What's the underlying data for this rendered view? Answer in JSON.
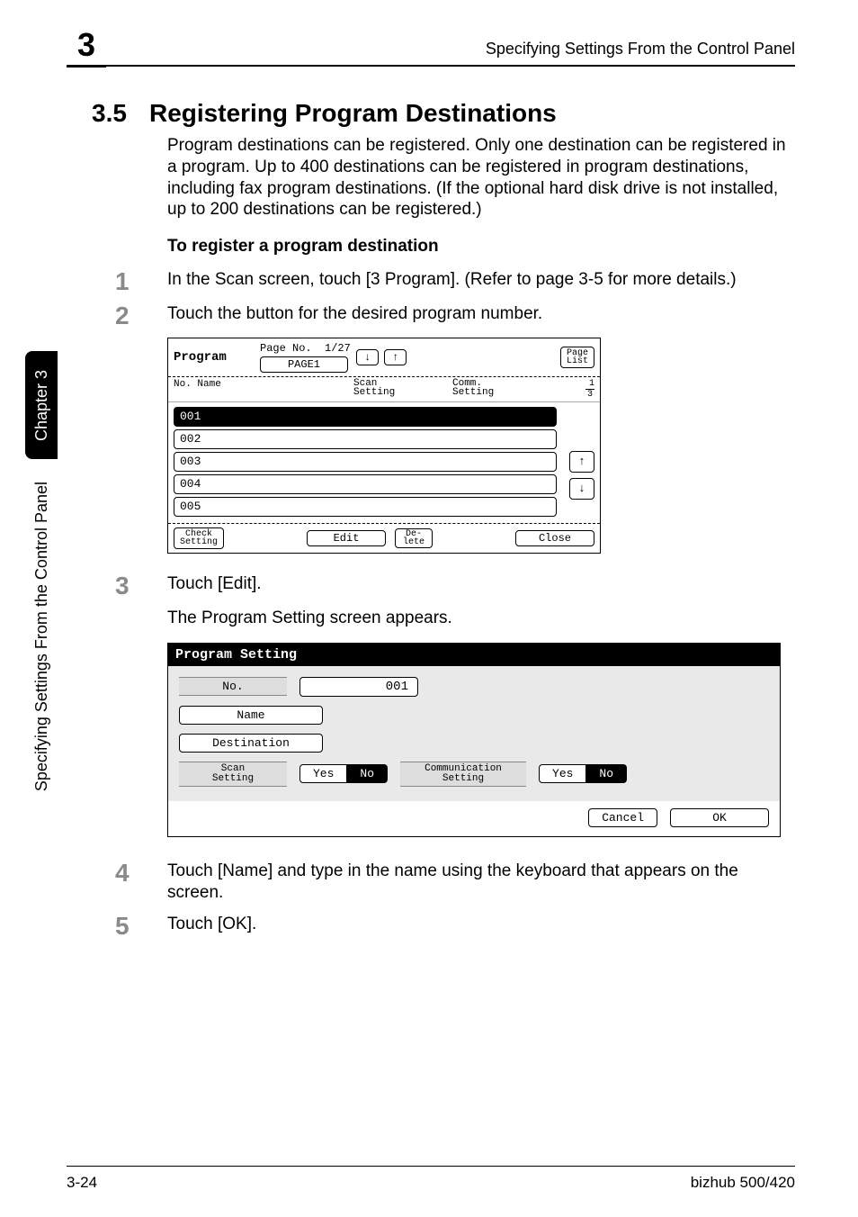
{
  "header": {
    "chapter_number": "3",
    "running_title": "Specifying Settings From the Control Panel"
  },
  "sidetab": {
    "chapter_label": "Chapter 3",
    "side_title": "Specifying Settings From the Control Panel"
  },
  "section": {
    "number": "3.5",
    "title": "Registering Program Destinations",
    "intro": "Program destinations can be registered. Only one destination can be registered in a program. Up to 400 destinations can be registered in program destinations, including fax program destinations. (If the optional hard disk drive is not installed, up to 200 destinations can be registered.)",
    "procedure_title": "To register a program destination"
  },
  "steps": [
    {
      "num": "1",
      "text": "In the Scan screen, touch [3 Program]. (Refer to page 3-5 for more details.)"
    },
    {
      "num": "2",
      "text": "Touch the button for the desired program number."
    },
    {
      "num": "3",
      "text": "Touch [Edit].",
      "after": "The Program Setting screen appears."
    },
    {
      "num": "4",
      "text": "Touch [Name] and type in the name using the keyboard that appears on the screen."
    },
    {
      "num": "5",
      "text": "Touch [OK]."
    }
  ],
  "scr1": {
    "title": "Program",
    "page_no_label": "Page No.",
    "page_no_value": "1/27",
    "page_name_btn": "PAGE1",
    "arrow_down": "↓",
    "arrow_up": "↑",
    "page_list_btn": "Page\nList",
    "col_no_name": "No. Name",
    "col_scan": "Scan\nSetting",
    "col_comm": "Comm.\nSetting",
    "frac_top": "1",
    "frac_bot": "3",
    "rows": [
      "001",
      "002",
      "003",
      "004",
      "005"
    ],
    "btn_check": "Check\nSetting",
    "btn_edit": "Edit",
    "btn_delete": "De-\nlete",
    "btn_close": "Close"
  },
  "scr2": {
    "title": "Program Setting",
    "label_no": "No.",
    "value_no": "001",
    "btn_name": "Name",
    "btn_dest": "Destination",
    "label_scan": "Scan\nSetting",
    "yes": "Yes",
    "no": "No",
    "label_comm": "Communication\nSetting",
    "btn_cancel": "Cancel",
    "btn_ok": "OK"
  },
  "footer": {
    "left": "3-24",
    "right": "bizhub 500/420"
  }
}
